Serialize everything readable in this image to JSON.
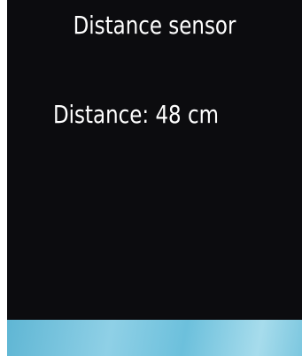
{
  "app": {
    "title": "Distance sensor"
  },
  "reading": {
    "label": "Distance:",
    "value": "48",
    "unit": "cm"
  },
  "colors": {
    "screen_background": "#0c0c0f",
    "text": "#ffffff",
    "bottom_bar": "#7cc7df"
  }
}
